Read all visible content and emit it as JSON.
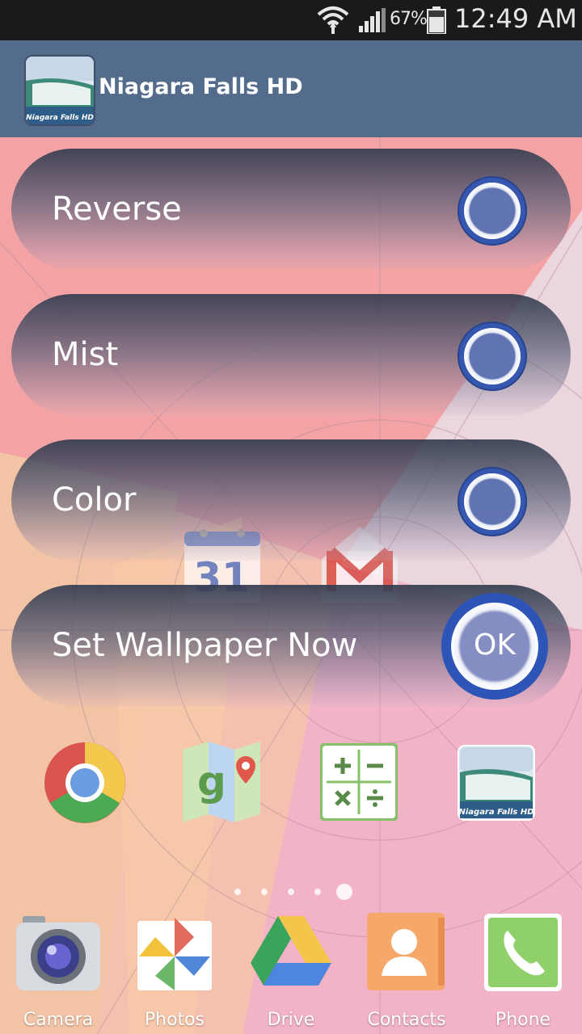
{
  "status_bar": {
    "battery_percent": "67%",
    "time": "12:49 AM"
  },
  "app": {
    "title": "Niagara Falls HD",
    "icon_caption": "Niagara Falls HD"
  },
  "options": [
    {
      "label": "Reverse"
    },
    {
      "label": "Mist"
    },
    {
      "label": "Color"
    }
  ],
  "set_wallpaper": {
    "label": "Set Wallpaper Now",
    "button_label": "OK"
  },
  "home_icons": {
    "calendar_day": "31",
    "wallpaper_app_caption": "Niagara Falls HD"
  },
  "dock": [
    {
      "label": "Camera"
    },
    {
      "label": "Photos"
    },
    {
      "label": "Drive"
    },
    {
      "label": "Contacts"
    },
    {
      "label": "Phone"
    }
  ],
  "colors": {
    "title_bar": "#546c8c",
    "radio_ring": "#3557b0",
    "status_bar": "#1a1a1a"
  }
}
